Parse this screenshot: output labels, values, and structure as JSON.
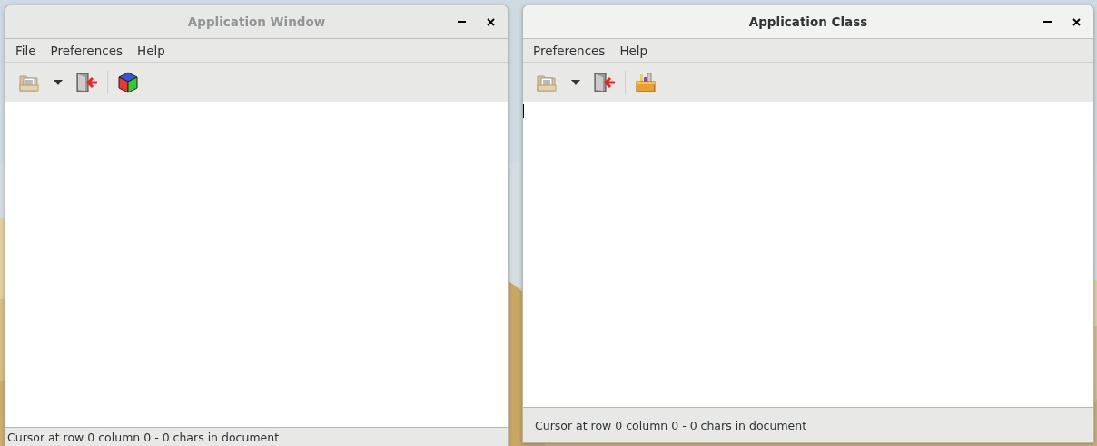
{
  "desktop": {
    "kind": "wallpaper"
  },
  "windows": [
    {
      "title": "Application Window",
      "active": false,
      "menu": [
        "File",
        "Preferences",
        "Help"
      ],
      "toolbar": [
        {
          "kind": "open"
        },
        {
          "kind": "dropdown"
        },
        {
          "kind": "quit"
        },
        {
          "kind": "separator"
        },
        {
          "kind": "cube"
        }
      ],
      "text_cursor": false,
      "status": "Cursor at row 0 column 0 - 0 chars in document"
    },
    {
      "title": "Application Class",
      "active": true,
      "menu": [
        "Preferences",
        "Help"
      ],
      "toolbar": [
        {
          "kind": "open"
        },
        {
          "kind": "dropdown"
        },
        {
          "kind": "quit"
        },
        {
          "kind": "separator"
        },
        {
          "kind": "toolbox"
        }
      ],
      "text_cursor": true,
      "status": "Cursor at row 0 column 0 - 0 chars in document"
    }
  ]
}
